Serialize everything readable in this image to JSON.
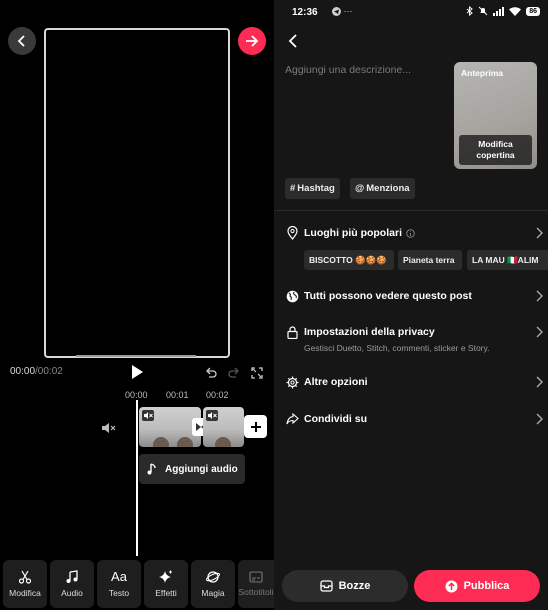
{
  "editor": {
    "time_current": "00:00",
    "time_total": "/00:02",
    "ticks": [
      "00:00",
      "00:01",
      "00:02"
    ],
    "add_audio_label": "Aggiungi audio",
    "tools": [
      {
        "label": "Modifica",
        "icon": "scissors-icon"
      },
      {
        "label": "Audio",
        "icon": "music-note-icon"
      },
      {
        "label": "Testo",
        "icon": "text-aa-icon"
      },
      {
        "label": "Effetti",
        "icon": "sparkle-icon"
      },
      {
        "label": "Magia",
        "icon": "magic-icon"
      },
      {
        "label": "Sottotitoli",
        "icon": "captions-icon"
      }
    ]
  },
  "post": {
    "status_time": "12:36",
    "status_dots": "···",
    "battery": "86",
    "description_placeholder": "Aggiungi una descrizione...",
    "cover_label": "Anteprima",
    "cover_edit": "Modifica copertina",
    "hashtag_label": "Hashtag",
    "mention_label": "Menziona",
    "popular_places": "Luoghi più popolari",
    "places": [
      "BISCOTTO 🍪🍪🍪",
      "Pianeta terra",
      "LA MAU 🇮🇹ALIM"
    ],
    "visibility": "Tutti possono vedere questo post",
    "privacy_title": "Impostazioni della privacy",
    "privacy_sub": "Gestisci Duetto, Stitch, commenti, sticker e Story.",
    "more_options": "Altre opzioni",
    "share_on": "Condividi su",
    "drafts_label": "Bozze",
    "publish_label": "Pubblica"
  },
  "colors": {
    "accent": "#fe2c55",
    "panel": "#161616",
    "chip": "#2b2b2b"
  }
}
